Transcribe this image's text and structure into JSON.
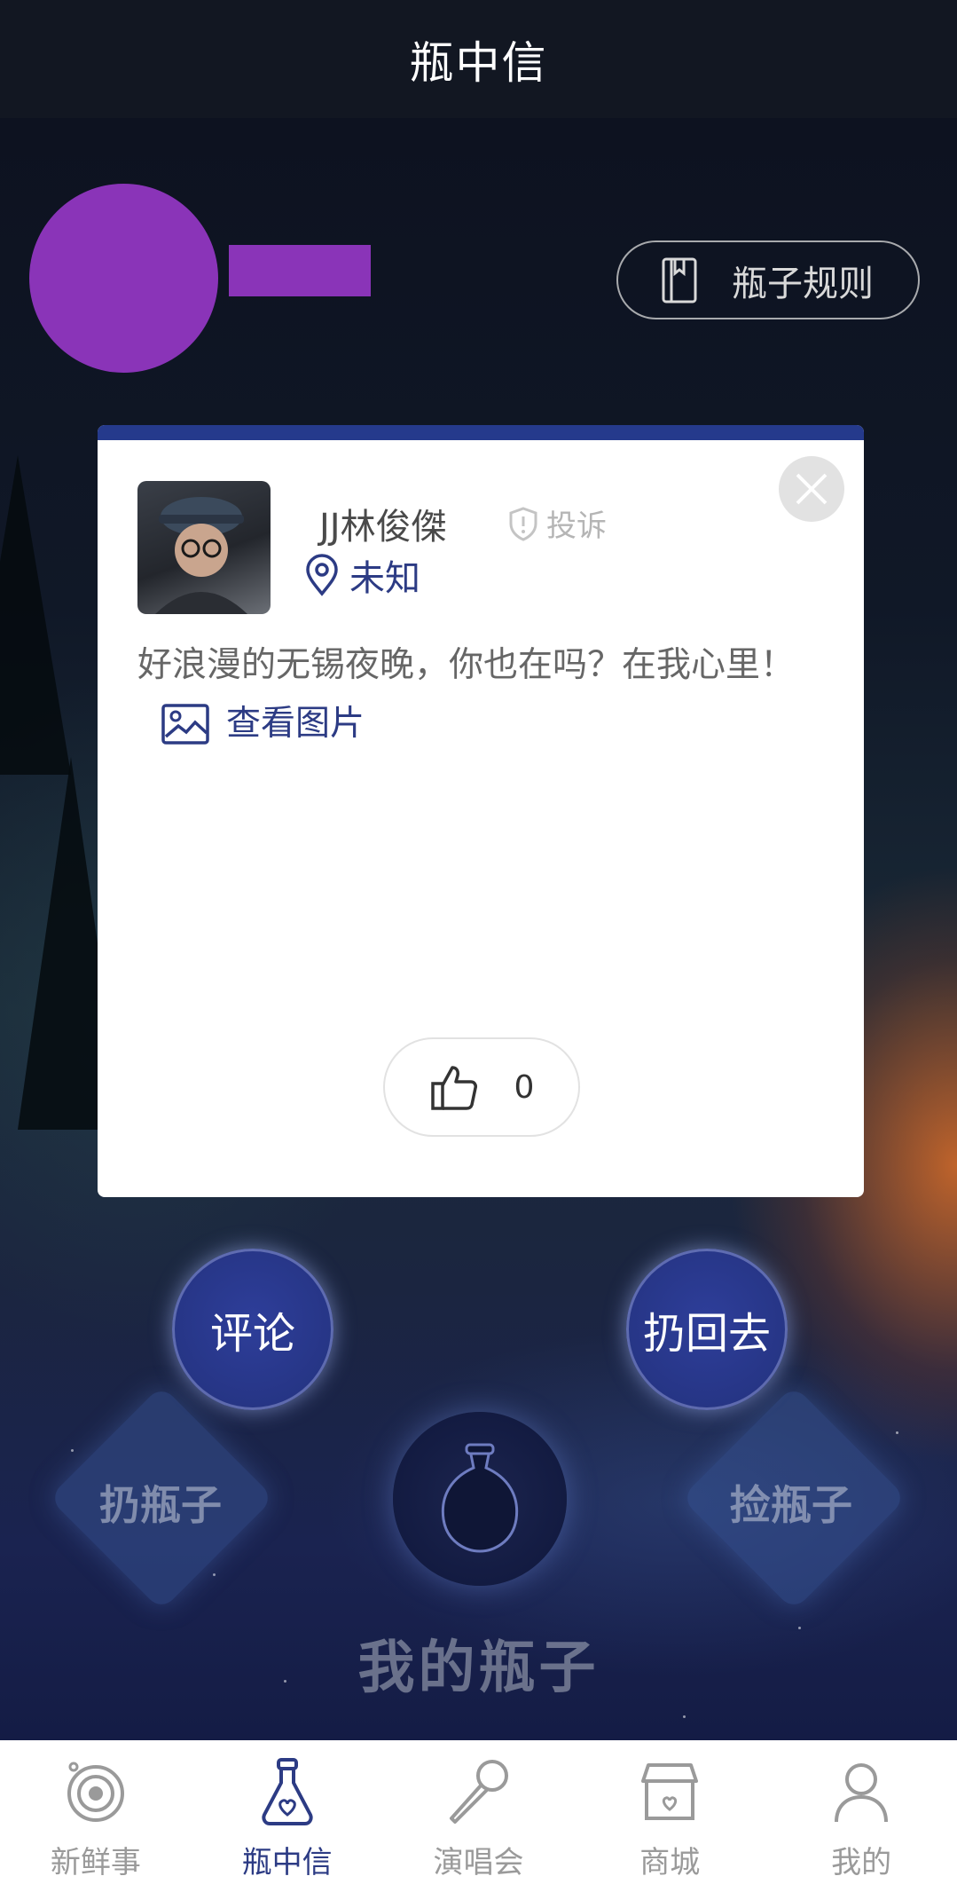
{
  "header": {
    "title": "瓶中信"
  },
  "profile": {
    "rules_label": "瓶子规则"
  },
  "card": {
    "username": "JJ林俊傑",
    "report_label": "投诉",
    "location": "未知",
    "message": "好浪漫的无锡夜晚，你也在吗？在我心里！",
    "view_image_label": "查看图片",
    "like_count": "0"
  },
  "actions": {
    "comment_label": "评论",
    "throw_back_label": "扔回去",
    "throw_bottle_label": "扔瓶子",
    "pick_bottle_label": "捡瓶子",
    "my_bottles_label": "我的瓶子"
  },
  "tabbar": {
    "items": [
      {
        "label": "新鲜事",
        "icon": "target-icon",
        "active": false
      },
      {
        "label": "瓶中信",
        "icon": "bottle-icon",
        "active": true
      },
      {
        "label": "演唱会",
        "icon": "microphone-icon",
        "active": false
      },
      {
        "label": "商城",
        "icon": "store-icon",
        "active": false
      },
      {
        "label": "我的",
        "icon": "user-icon",
        "active": false
      }
    ]
  },
  "colors": {
    "accent": "#2c3b84",
    "placeholder_purple": "#8a34b8",
    "topbar": "#121722"
  }
}
